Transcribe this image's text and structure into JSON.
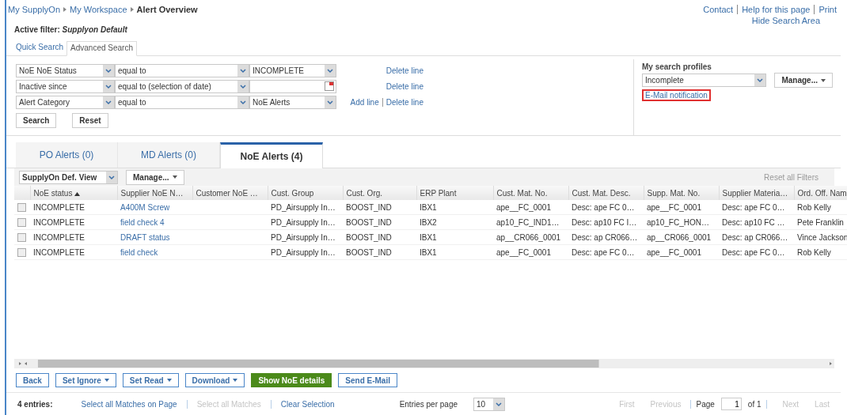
{
  "breadcrumb": [
    {
      "label": "My SupplyOn",
      "current": false
    },
    {
      "label": "My Workspace",
      "current": false
    },
    {
      "label": "Alert Overview",
      "current": true
    }
  ],
  "top_links": [
    "Contact",
    "Help for this page",
    "Print"
  ],
  "hide_search_link": "Hide Search Area",
  "active_filter": {
    "label": "Active filter:",
    "value": "Supplyon Default"
  },
  "search_tabs": [
    {
      "label": "Quick Search",
      "selected": false
    },
    {
      "label": "Advanced Search",
      "selected": true
    }
  ],
  "filter_lines": [
    {
      "field": "NoE NoE Status",
      "operator": "equal to",
      "kind": "select",
      "value": "INCOMPLETE",
      "links": [
        "Delete line"
      ]
    },
    {
      "field": "Inactive since",
      "operator": "equal to (selection of date)",
      "kind": "date",
      "links": [
        "Delete line"
      ]
    },
    {
      "field": "Alert Category",
      "operator": "equal to",
      "kind": "select",
      "value": "NoE Alerts",
      "links": [
        "Add line",
        "Delete line"
      ]
    }
  ],
  "filter_buttons": [
    "Search",
    "Reset"
  ],
  "profiles": {
    "title": "My search profiles",
    "value": "Incomplete",
    "manage": "Manage...",
    "email_link": "E-Mail notification",
    "email_highlighted": true
  },
  "alert_tabs": [
    {
      "label": "PO Alerts (0)",
      "selected": false
    },
    {
      "label": "MD Alerts (0)",
      "selected": false
    },
    {
      "label": "NoE Alerts (4)",
      "selected": true
    }
  ],
  "view": {
    "value": "SupplyOn Def. View",
    "manage": "Manage...",
    "reset_filters": "Reset all Filters"
  },
  "table": {
    "columns": [
      {
        "label": "NoE status",
        "sorted": true,
        "kind": "text"
      },
      {
        "label": "Supplier NoE N…",
        "sorted": false,
        "kind": "link"
      },
      {
        "label": "Customer NoE …",
        "sorted": false,
        "kind": "text"
      },
      {
        "label": "Cust. Group",
        "sorted": false,
        "kind": "text"
      },
      {
        "label": "Cust. Org.",
        "sorted": false,
        "kind": "text"
      },
      {
        "label": "ERP Plant",
        "sorted": false,
        "kind": "text"
      },
      {
        "label": "Cust. Mat. No.",
        "sorted": false,
        "kind": "text"
      },
      {
        "label": "Cust. Mat. Desc.",
        "sorted": false,
        "kind": "text"
      },
      {
        "label": "Supp. Mat. No.",
        "sorted": false,
        "kind": "text"
      },
      {
        "label": "Supplier Materia…",
        "sorted": false,
        "kind": "text"
      },
      {
        "label": "Ord. Off. Nam",
        "sorted": false,
        "kind": "text"
      }
    ],
    "rows": [
      {
        "checked": false,
        "cells": [
          "INCOMPLETE",
          "A400M Screw",
          "",
          "PD_Airsupply In…",
          "BOOST_IND",
          "IBX1",
          "ape__FC_0001",
          "Desc: ape FC 0…",
          "ape__FC_0001",
          "Desc: ape FC 0…",
          "Rob Kelly"
        ]
      },
      {
        "checked": false,
        "cells": [
          "INCOMPLETE",
          "field check 4",
          "",
          "PD_Airsupply In…",
          "BOOST_IND",
          "IBX2",
          "ap10_FC_IND1…",
          "Desc: ap10 FC I…",
          "ap10_FC_HON…",
          "Desc: ap10 FC …",
          "Pete Franklin"
        ]
      },
      {
        "checked": false,
        "cells": [
          "INCOMPLETE",
          "DRAFT status",
          "",
          "PD_Airsupply In…",
          "BOOST_IND",
          "IBX1",
          "ap__CR066_0001",
          "Desc: ap CR066…",
          "ap__CR066_0001",
          "Desc: ap CR066…",
          "Vince Jackson"
        ]
      },
      {
        "checked": false,
        "cells": [
          "INCOMPLETE",
          "field check",
          "",
          "PD_Airsupply In…",
          "BOOST_IND",
          "IBX1",
          "ape__FC_0001",
          "Desc: ape FC 0…",
          "ape__FC_0001",
          "Desc: ape FC 0…",
          "Rob Kelly"
        ]
      }
    ]
  },
  "actions": [
    {
      "label": "Back",
      "kind": "plain"
    },
    {
      "label": "Set Ignore",
      "kind": "menu"
    },
    {
      "label": "Set Read",
      "kind": "menu"
    },
    {
      "label": "Download",
      "kind": "menu"
    },
    {
      "label": "Show NoE details",
      "kind": "primary"
    },
    {
      "label": "Send E-Mail",
      "kind": "plain"
    }
  ],
  "footer": {
    "count": "4 entries:",
    "selection_links": [
      {
        "label": "Select all Matches on Page",
        "disabled": false
      },
      {
        "label": "Select all Matches",
        "disabled": true
      },
      {
        "label": "Clear Selection",
        "disabled": false
      }
    ],
    "per_page_label": "Entries per page",
    "per_page": "10",
    "nav_before": [
      {
        "label": "First",
        "disabled": true
      },
      {
        "label": "Previous",
        "disabled": true
      }
    ],
    "page_label": "Page",
    "page": "1",
    "page_of": "of 1",
    "nav_after": [
      {
        "label": "Next",
        "disabled": true
      },
      {
        "label": "Last",
        "disabled": true
      }
    ]
  }
}
